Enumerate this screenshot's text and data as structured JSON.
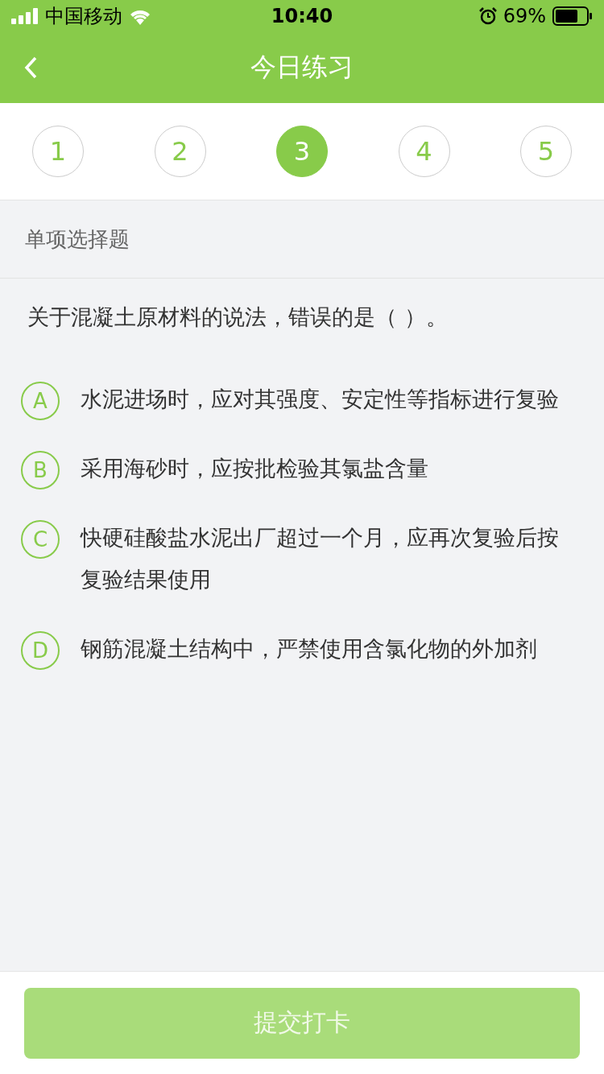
{
  "status_bar": {
    "carrier": "中国移动",
    "time": "10:40",
    "battery": "69%"
  },
  "nav": {
    "title": "今日练习"
  },
  "steps": [
    {
      "label": "1",
      "selected": false
    },
    {
      "label": "2",
      "selected": false
    },
    {
      "label": "3",
      "selected": true
    },
    {
      "label": "4",
      "selected": false
    },
    {
      "label": "5",
      "selected": false
    }
  ],
  "question": {
    "type": "单项选择题",
    "text": "关于混凝土原材料的说法，错误的是（    ）。",
    "options": [
      {
        "letter": "A",
        "text": "水泥进场时，应对其强度、安定性等指标进行复验",
        "selected": false
      },
      {
        "letter": "B",
        "text": "采用海砂时，应按批检验其氯盐含量",
        "selected": false
      },
      {
        "letter": "C",
        "text": "快硬硅酸盐水泥出厂超过一个月，应再次复验后按复验结果使用",
        "selected": false
      },
      {
        "letter": "D",
        "text": "钢筋混凝土结构中，严禁使用含氯化物的外加剂",
        "selected": false
      }
    ]
  },
  "submit": {
    "label": "提交打卡",
    "disabled": true
  }
}
